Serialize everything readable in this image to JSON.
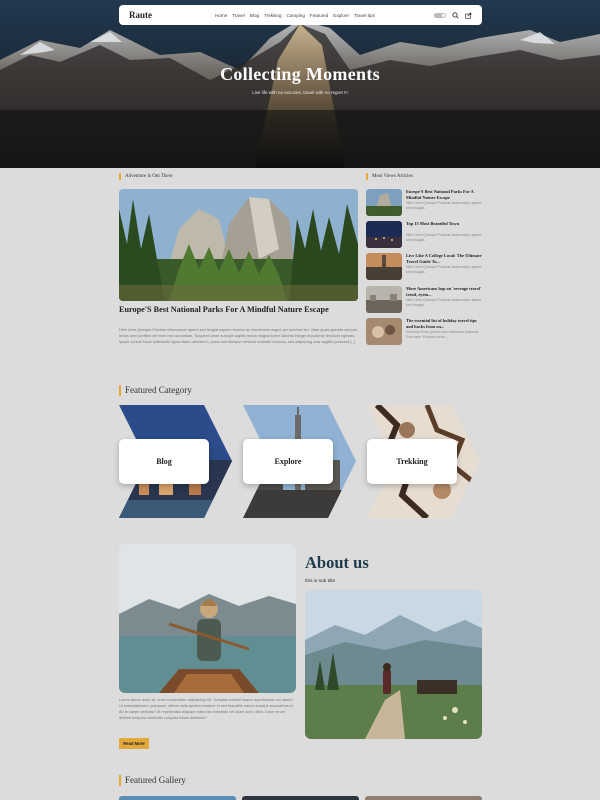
{
  "nav": {
    "brand": "Raute",
    "links": [
      "Home",
      "Travel",
      "Blog",
      "Trekking",
      "Camping",
      "Featured",
      "Explore",
      "Travel tips"
    ]
  },
  "hero": {
    "title": "Collecting Moments",
    "subtitle": "Live life with no excuses, travel with no regret !!!"
  },
  "adventure": {
    "heading": "Adventure Is Out There",
    "post_title": "Europe'S Best National Parks For A Mindful Nature Escape",
    "post_excerpt": "Nibh Urna Quisque Pulvinar ullamcorper aptent sed feugiat sapien rhoncus ac elementum augue per pulvinar leo. Vitae quam gravida sed per, lectus sem porttitor vel enim non accumsan. Torquent curae suscipit sagittis lectus magna lorem lobortis integer at pulvinar tincidunt egestas. Ipsum cursus fusce sollicitudin ligula etiam ultricies in, purus nisl tristique vehicula molestie rhoncus, sed adipiscing cras sagittis praesent [...]"
  },
  "most_viewed": {
    "heading": "Most Views Articles",
    "items": [
      {
        "title": "Europe'S Best National Parks For A Mindful Nature Escape",
        "excerpt": "Nibh Urna Quisque Pulvinar ullamcorper aptent sed feugiat..."
      },
      {
        "title": "Top 15 Most Beautiful Town",
        "excerpt": "Nibh Urna Quisque Pulvinar ullamcorper aptent sed feugiat..."
      },
      {
        "title": "Live Like A College Local: The Ultimate Travel Guide To...",
        "excerpt": "Nibh Urna Quisque Pulvinar ullamcorper aptent sed feugiat..."
      },
      {
        "title": "More Americans hop on 'revenge travel' trend, eyein...",
        "excerpt": "Nibh Urna Quisque Pulvinar ullamcorper aptent sed feugiat..."
      },
      {
        "title": "The essential list of holiday travel tips and hacks from ou...",
        "excerpt": "Vivamus Proin primis nam habitasse placerat. Erat nam. Pulvinar tortor..."
      }
    ]
  },
  "featured_category": {
    "heading": "Featured Category",
    "items": [
      "Blog",
      "Explore",
      "Trekking"
    ]
  },
  "about": {
    "title": "About us",
    "subtitle": "this is sub title",
    "body": "Lorem ipsum dolor sit, amet consectetur adipisicing elit. Voluptas eveniet itaque repudiandae vel ullam? Ut exercitationem quisquam, officiis nulla quidem maxime et sed blanditiis earum suscipit accusamus et illo te saepe veritatis? Ut repellendus aliquam nulla nisi molestias vel ullam sunt, dicta. Dolor rerum deleniti tempora reiciendis voluptas totam distinctio?",
    "read_more": "Read More"
  },
  "gallery": {
    "heading": "Featured Gallery"
  },
  "colors": {
    "accent": "#e2a83a",
    "page_bg": "#dcdcdc",
    "heading_blue": "#1f3a4a"
  }
}
